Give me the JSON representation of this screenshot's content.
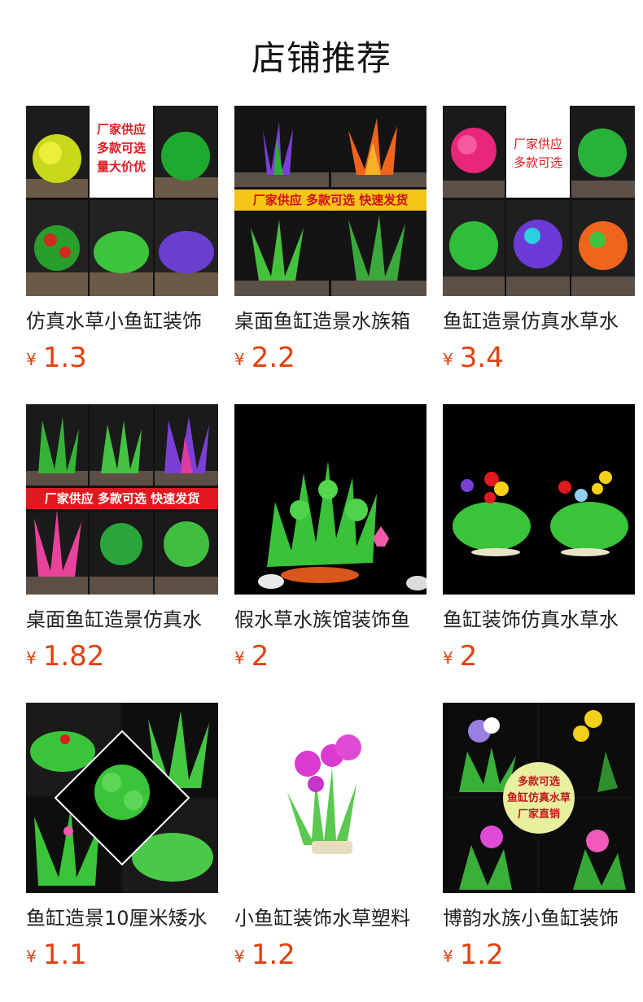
{
  "page_title": "店铺推荐",
  "currency": "¥",
  "products": [
    {
      "name": "仿真水草小鱼缸装饰",
      "price": "1.3",
      "badge": [
        "厂家供应",
        "多款可选",
        "量大价优"
      ]
    },
    {
      "name": "桌面鱼缸造景水族箱",
      "price": "2.2",
      "badge": [
        "厂家供应 多款可选 快速发货"
      ]
    },
    {
      "name": "鱼缸造景仿真水草水",
      "price": "3.4",
      "badge": [
        "厂家供应",
        "多款可选"
      ]
    },
    {
      "name": "桌面鱼缸造景仿真水",
      "price": "1.82",
      "badge": [
        "厂家供应 多款可选 快速发货"
      ]
    },
    {
      "name": "假水草水族馆装饰鱼",
      "price": "2",
      "badge": []
    },
    {
      "name": "鱼缸装饰仿真水草水",
      "price": "2",
      "badge": []
    },
    {
      "name": "鱼缸造景10厘米矮水",
      "price": "1.1",
      "badge": []
    },
    {
      "name": "小鱼缸装饰水草塑料",
      "price": "1.2",
      "badge": []
    },
    {
      "name": "博韵水族小鱼缸装饰",
      "price": "1.2",
      "badge": [
        "多款可选",
        "鱼缸仿真水草",
        "厂家直销"
      ]
    }
  ],
  "colors": {
    "price": "#e2410f",
    "banner_red": "#e0191f",
    "banner_yellow": "#f5c518"
  }
}
